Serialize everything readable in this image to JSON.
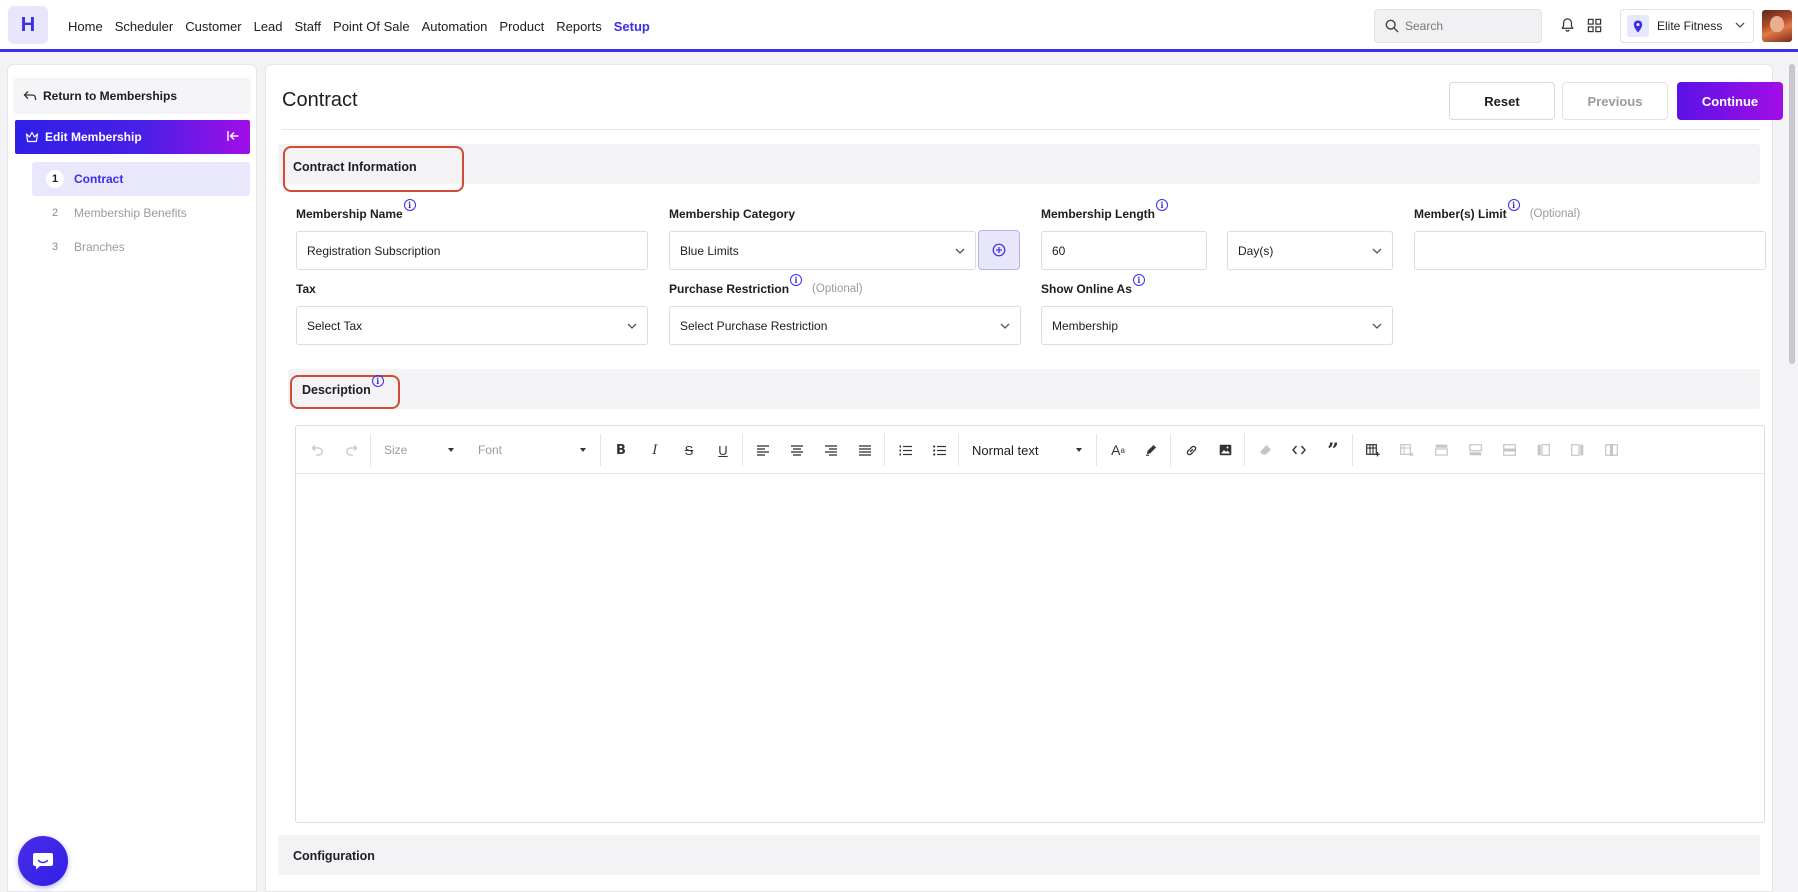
{
  "app": {
    "logo_letter": "H"
  },
  "nav": {
    "items": [
      "Home",
      "Scheduler",
      "Customer",
      "Lead",
      "Staff",
      "Point Of Sale",
      "Automation",
      "Product",
      "Reports",
      "Setup"
    ],
    "active": "Setup"
  },
  "search": {
    "placeholder": "Search"
  },
  "location": {
    "label": "Elite Fitness"
  },
  "sidebar": {
    "return_label": "Return to Memberships",
    "section_label": "Edit Membership",
    "steps": [
      {
        "num": "1",
        "label": "Contract"
      },
      {
        "num": "2",
        "label": "Membership Benefits"
      },
      {
        "num": "3",
        "label": "Branches"
      }
    ]
  },
  "main": {
    "title": "Contract",
    "buttons": {
      "reset": "Reset",
      "previous": "Previous",
      "continue": "Continue"
    },
    "contract_info": {
      "heading": "Contract Information",
      "membership_name": {
        "label": "Membership Name",
        "value": "Registration Subscription"
      },
      "membership_category": {
        "label": "Membership Category",
        "value": "Blue Limits"
      },
      "membership_length": {
        "label": "Membership Length",
        "value": "60",
        "unit": "Day(s)"
      },
      "member_limit": {
        "label": "Member(s) Limit",
        "optional": "(Optional)",
        "value": ""
      },
      "tax": {
        "label": "Tax",
        "value": "Select Tax"
      },
      "purchase_restriction": {
        "label": "Purchase Restriction",
        "optional": "(Optional)",
        "value": "Select Purchase Restriction"
      },
      "show_online_as": {
        "label": "Show Online As",
        "value": "Membership"
      }
    },
    "description": {
      "heading": "Description",
      "toolbar": {
        "size": "Size",
        "font": "Font",
        "block": "Normal text"
      }
    },
    "configuration": {
      "heading": "Configuration"
    }
  },
  "colors": {
    "brand": "#3b2ee8",
    "accent_end": "#a10ee6",
    "highlight": "#d34b33"
  }
}
